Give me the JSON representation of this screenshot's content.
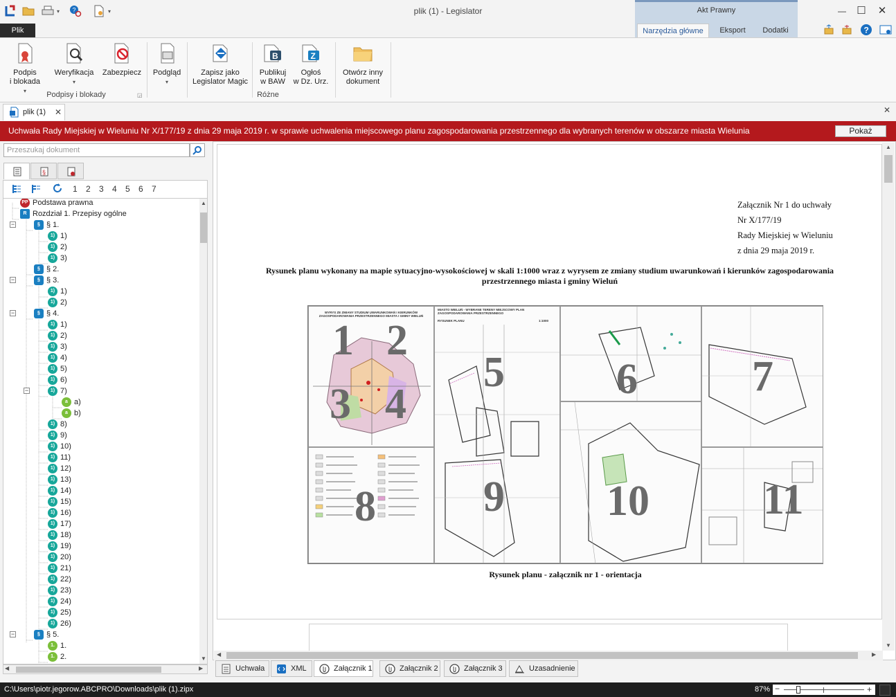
{
  "window": {
    "title": "plik (1) - Legislator",
    "context_group": "Akt Prawny",
    "minimize": "—",
    "maximize": "☐",
    "close": "✕"
  },
  "ribbon_tabs": {
    "file": "Plik",
    "main_tools": "Narzędzia główne",
    "export": "Eksport",
    "addons": "Dodatki"
  },
  "ribbon": {
    "sign_block_label": "Podpis\ni blokada",
    "verify_label": "Weryfikacja",
    "secure_label": "Zabezpiecz",
    "preview_label": "Podgląd",
    "save_magic_label": "Zapisz jako\nLegislator Magic",
    "publish_baw_label": "Publikuj\nw BAW",
    "announce_label": "Ogłoś\nw Dz. Urz.",
    "open_other_label": "Otwórz inny\ndokument",
    "group_signatures": "Podpisy i blokady",
    "group_misc": "Różne"
  },
  "document_tab": {
    "label": "plik (1)"
  },
  "banner": {
    "text": "Uchwała Rady Miejskiej w Wieluniu Nr X/177/19 z dnia 29 maja 2019 r. w sprawie uchwalenia miejscowego planu zagospodarowania przestrzennego dla wybranych terenów w obszarze miasta Wielunia",
    "button": "Pokaż"
  },
  "search": {
    "placeholder": "Przeszukaj dokument"
  },
  "tree_levels": [
    "1",
    "2",
    "3",
    "4",
    "5",
    "6",
    "7"
  ],
  "tree": [
    {
      "label": "Podstawa prawna",
      "icon": "PP"
    },
    {
      "label": "Rozdział 1. Przepisy ogólne",
      "icon": "R"
    },
    {
      "label": "§ 1.",
      "icon": "§"
    },
    {
      "label": "1)",
      "icon": "1)"
    },
    {
      "label": "2)",
      "icon": "1)"
    },
    {
      "label": "3)",
      "icon": "1)"
    },
    {
      "label": "§ 2.",
      "icon": "§"
    },
    {
      "label": "§ 3.",
      "icon": "§"
    },
    {
      "label": "1)",
      "icon": "1)"
    },
    {
      "label": "2)",
      "icon": "1)"
    },
    {
      "label": "§ 4.",
      "icon": "§"
    },
    {
      "label": "1)",
      "icon": "1)"
    },
    {
      "label": "2)",
      "icon": "1)"
    },
    {
      "label": "3)",
      "icon": "1)"
    },
    {
      "label": "4)",
      "icon": "1)"
    },
    {
      "label": "5)",
      "icon": "1)"
    },
    {
      "label": "6)",
      "icon": "1)"
    },
    {
      "label": "7)",
      "icon": "1)"
    },
    {
      "label": "a)",
      "icon": "a"
    },
    {
      "label": "b)",
      "icon": "a"
    },
    {
      "label": "8)",
      "icon": "1)"
    },
    {
      "label": "9)",
      "icon": "1)"
    },
    {
      "label": "10)",
      "icon": "1)"
    },
    {
      "label": "11)",
      "icon": "1)"
    },
    {
      "label": "12)",
      "icon": "1)"
    },
    {
      "label": "13)",
      "icon": "1)"
    },
    {
      "label": "14)",
      "icon": "1)"
    },
    {
      "label": "15)",
      "icon": "1)"
    },
    {
      "label": "16)",
      "icon": "1)"
    },
    {
      "label": "17)",
      "icon": "1)"
    },
    {
      "label": "18)",
      "icon": "1)"
    },
    {
      "label": "19)",
      "icon": "1)"
    },
    {
      "label": "20)",
      "icon": "1)"
    },
    {
      "label": "21)",
      "icon": "1)"
    },
    {
      "label": "22)",
      "icon": "1)"
    },
    {
      "label": "23)",
      "icon": "1)"
    },
    {
      "label": "24)",
      "icon": "1)"
    },
    {
      "label": "25)",
      "icon": "1)"
    },
    {
      "label": "26)",
      "icon": "1)"
    },
    {
      "label": "§ 5.",
      "icon": "§"
    },
    {
      "label": "1.",
      "icon": "1."
    },
    {
      "label": "2.",
      "icon": "1."
    }
  ],
  "document": {
    "attachment_lines": [
      "Załącznik Nr 1 do uchwały",
      "Nr X/177/19",
      "Rady Miejskiej w Wieluniu",
      "z dnia 29 maja 2019 r."
    ],
    "heading": "Rysunek planu wykonany na mapie sytuacyjno-wysokościowej w skali 1:1000 wraz z wyrysem ze zmiany studium uwarunkowań i kierunków zagospodarowania przestrzennego miasta i gminy Wieluń",
    "map_numbers": [
      "1",
      "2",
      "3",
      "4",
      "5",
      "6",
      "7",
      "8",
      "9",
      "10",
      "11"
    ],
    "map_header_left": "WYRYS ZE ZMIANY STUDIUM UWARUNKOWAŃ I KIERUNKÓW ZAGOSPODAROWANIA PRZESTRZENNEGO MIASTA I GMINY WIELUŃ",
    "map_header_mid": "MIASTO WIELUŃ - WYBRANE TERENY MIEJSCOWY PLAN ZAGOSPODAROWANIA PRZESTRZENNEGO",
    "map_header_mid2": "RYSUNEK PLANU",
    "map_scale": "1:1000",
    "caption": "Rysunek planu - załącznik nr 1 - orientacja"
  },
  "bottom_tabs": [
    "Uchwała",
    "XML",
    "Załącznik 1",
    "Załącznik 2",
    "Załącznik 3",
    "Uzasadnienie"
  ],
  "status": {
    "path": "C:\\Users\\piotr.jegorow.ABCPRO\\Downloads\\plik (1).zipx",
    "zoom": "87%"
  },
  "colors": {
    "banner": "#b4191d",
    "accent": "#1a7fc1",
    "point_icon": "#17a79a",
    "letter_icon": "#7bbf3a"
  }
}
